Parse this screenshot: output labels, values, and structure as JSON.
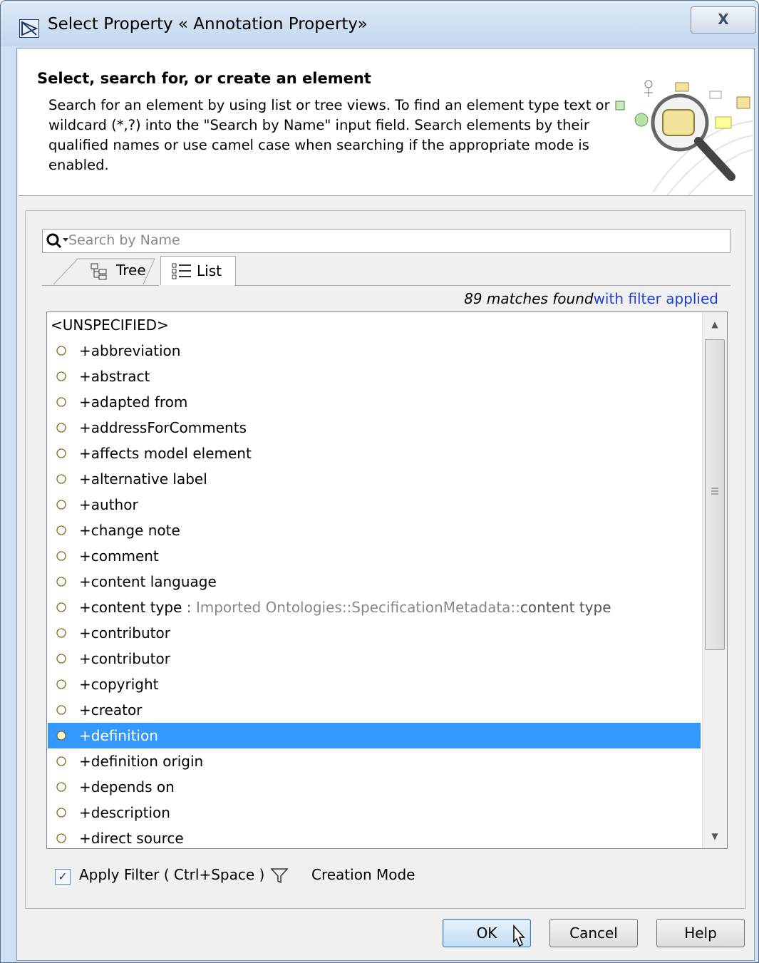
{
  "window": {
    "title": "Select Property « Annotation Property»",
    "close_label": "X"
  },
  "header": {
    "title": "Select, search for, or create an element",
    "description": "Search for an element by using list or tree views. To find an element type text or wildcard (*,?) into the \"Search by Name\" input field. Search elements by their qualified names or use camel case when searching if the appropriate mode is enabled."
  },
  "search": {
    "placeholder": "Search by Name",
    "value": ""
  },
  "tabs": [
    {
      "label": "Tree",
      "icon": "tree-icon",
      "active": false
    },
    {
      "label": "List",
      "icon": "list-icon",
      "active": true
    }
  ],
  "matches": {
    "count_text": "89 matches found",
    "filter_text": "with filter applied"
  },
  "list": {
    "items": [
      {
        "label": "<UNSPECIFIED>",
        "icon": null
      },
      {
        "label": "+abbreviation",
        "icon": "property-icon"
      },
      {
        "label": "+abstract",
        "icon": "property-icon"
      },
      {
        "label": "+adapted from",
        "icon": "property-icon"
      },
      {
        "label": "+addressForComments",
        "icon": "property-icon"
      },
      {
        "label": "+affects model element",
        "icon": "property-icon"
      },
      {
        "label": "+alternative label",
        "icon": "property-icon"
      },
      {
        "label": "+author",
        "icon": "property-icon"
      },
      {
        "label": "+change note",
        "icon": "property-icon"
      },
      {
        "label": "+comment",
        "icon": "property-icon"
      },
      {
        "label": "+content language",
        "icon": "property-icon"
      },
      {
        "label": "+content type",
        "icon": "property-icon",
        "suffix_sep": " : ",
        "suffix_qualified": "Imported Ontologies::SpecificationMetadata::",
        "suffix_name": "content type"
      },
      {
        "label": "+contributor",
        "icon": "property-icon"
      },
      {
        "label": "+contributor",
        "icon": "property-icon"
      },
      {
        "label": "+copyright",
        "icon": "property-icon"
      },
      {
        "label": "+creator",
        "icon": "property-icon"
      },
      {
        "label": "+definition",
        "icon": "property-icon",
        "selected": true
      },
      {
        "label": "+definition origin",
        "icon": "property-icon"
      },
      {
        "label": "+depends on",
        "icon": "property-icon"
      },
      {
        "label": "+description",
        "icon": "property-icon"
      },
      {
        "label": "+direct source",
        "icon": "property-icon"
      }
    ]
  },
  "filter": {
    "apply_label": "Apply Filter ( Ctrl+Space )",
    "checked": true,
    "creation_mode_label": "Creation Mode"
  },
  "buttons": {
    "ok": "OK",
    "cancel": "Cancel",
    "help": "Help"
  },
  "colors": {
    "selection": "#3399ff",
    "link": "#1f3fd6"
  }
}
